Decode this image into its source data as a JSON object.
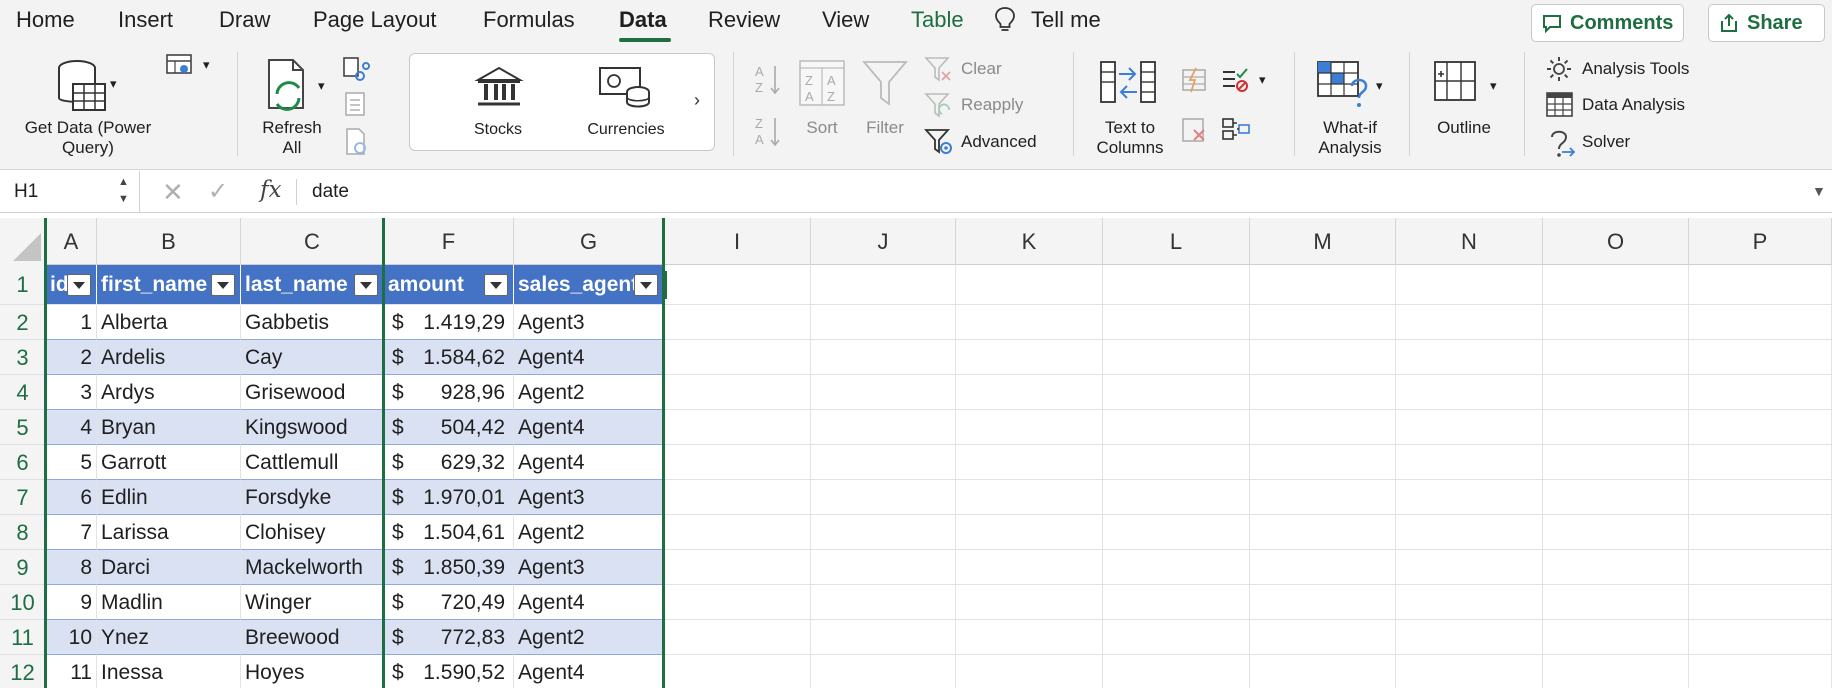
{
  "menu": {
    "tabs": [
      "Home",
      "Insert",
      "Draw",
      "Page Layout",
      "Formulas",
      "Data",
      "Review",
      "View",
      "Table"
    ],
    "active_tab": "Data",
    "tell_me": "Tell me",
    "comments_label": "Comments",
    "share_label": "Share"
  },
  "ribbon": {
    "get_data": "Get Data (Power Query)",
    "get_data_line1": "Get Data (Power",
    "get_data_line2": "Query)",
    "refresh_line1": "Refresh",
    "refresh_line2": "All",
    "stocks": "Stocks",
    "currencies": "Currencies",
    "sort": "Sort",
    "filter": "Filter",
    "clear": "Clear",
    "reapply": "Reapply",
    "advanced": "Advanced",
    "text_to_columns_line1": "Text to",
    "text_to_columns_line2": "Columns",
    "whatif_line1": "What-if",
    "whatif_line2": "Analysis",
    "outline": "Outline",
    "analysis_tools": "Analysis Tools",
    "data_analysis": "Data Analysis",
    "solver": "Solver"
  },
  "formula_bar": {
    "name_box": "H1",
    "fx": "fx",
    "value": "date"
  },
  "sheet": {
    "columns": [
      "A",
      "B",
      "C",
      "F",
      "G",
      "I",
      "J",
      "K",
      "L",
      "M",
      "N",
      "O",
      "P"
    ],
    "row_numbers": [
      "1",
      "2",
      "3",
      "4",
      "5",
      "6",
      "7",
      "8",
      "9",
      "10",
      "11",
      "12"
    ],
    "headers": [
      "id",
      "first_name",
      "last_name",
      "amount",
      "sales_agent"
    ],
    "rows": [
      {
        "id": "1",
        "first_name": "Alberta",
        "last_name": "Gabbetis",
        "currency": "$",
        "amount": "1.419,29",
        "agent": "Agent3"
      },
      {
        "id": "2",
        "first_name": "Ardelis",
        "last_name": "Cay",
        "currency": "$",
        "amount": "1.584,62",
        "agent": "Agent4"
      },
      {
        "id": "3",
        "first_name": "Ardys",
        "last_name": "Grisewood",
        "currency": "$",
        "amount": "928,96",
        "agent": "Agent2"
      },
      {
        "id": "4",
        "first_name": "Bryan",
        "last_name": "Kingswood",
        "currency": "$",
        "amount": "504,42",
        "agent": "Agent4"
      },
      {
        "id": "5",
        "first_name": "Garrott",
        "last_name": "Cattlemull",
        "currency": "$",
        "amount": "629,32",
        "agent": "Agent4"
      },
      {
        "id": "6",
        "first_name": "Edlin",
        "last_name": "Forsdyke",
        "currency": "$",
        "amount": "1.970,01",
        "agent": "Agent3"
      },
      {
        "id": "7",
        "first_name": "Larissa",
        "last_name": "Clohisey",
        "currency": "$",
        "amount": "1.504,61",
        "agent": "Agent2"
      },
      {
        "id": "8",
        "first_name": "Darci",
        "last_name": "Mackelworth",
        "currency": "$",
        "amount": "1.850,39",
        "agent": "Agent3"
      },
      {
        "id": "9",
        "first_name": "Madlin",
        "last_name": "Winger",
        "currency": "$",
        "amount": "720,49",
        "agent": "Agent4"
      },
      {
        "id": "10",
        "first_name": "Ynez",
        "last_name": "Breewood",
        "currency": "$",
        "amount": "772,83",
        "agent": "Agent2"
      },
      {
        "id": "11",
        "first_name": "Inessa",
        "last_name": "Hoyes",
        "currency": "$",
        "amount": "1.590,52",
        "agent": "Agent4"
      }
    ]
  },
  "colors": {
    "accent_green": "#1e6e42",
    "table_header": "#4472c4",
    "table_band": "#d9e1f2"
  }
}
